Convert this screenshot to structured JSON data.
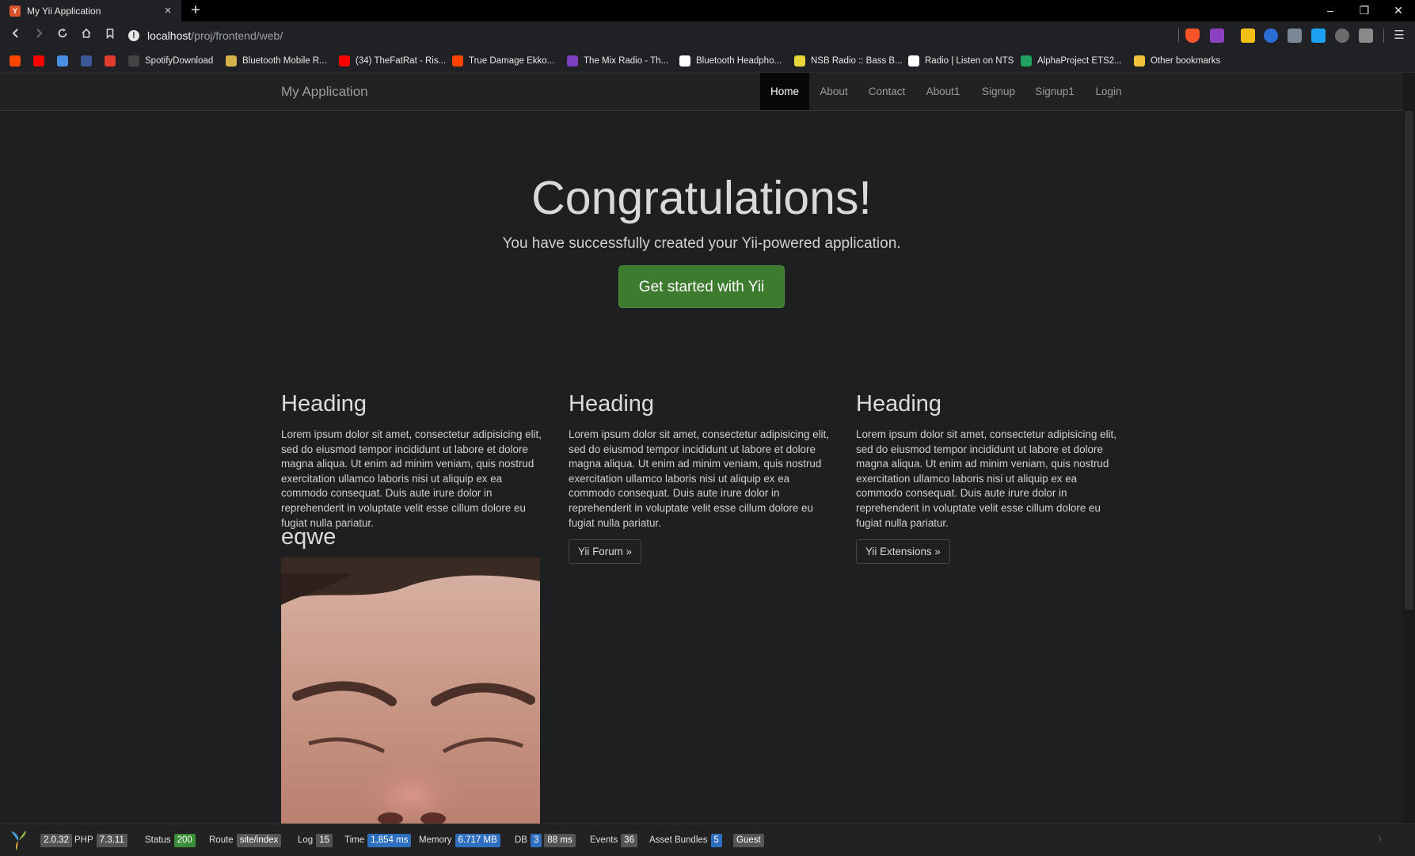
{
  "browser": {
    "tab_title": "My Yii Application",
    "tab_favicon": "yii-icon",
    "url_host": "localhost",
    "url_path": "/proj/frontend/web/",
    "bookmarks": [
      {
        "label": "",
        "icon": "reddit-icon",
        "color": "#ff4500"
      },
      {
        "label": "",
        "icon": "youtube-icon",
        "color": "#ff0000"
      },
      {
        "label": "",
        "icon": "messenger-icon",
        "color": "#4a90e2"
      },
      {
        "label": "",
        "icon": "facebook-icon",
        "color": "#3b5998"
      },
      {
        "label": "",
        "icon": "x-icon",
        "color": "#e03b2c"
      },
      {
        "label": "SpotifyDownload",
        "icon": "github-icon",
        "color": "#444444"
      },
      {
        "label": "Bluetooth Mobile R...",
        "icon": "bookmark-icon",
        "color": "#d6b24a"
      },
      {
        "label": "(34) TheFatRat - Ris...",
        "icon": "youtube-icon",
        "color": "#ff0000"
      },
      {
        "label": "True Damage Ekko...",
        "icon": "reddit-icon",
        "color": "#ff4500"
      },
      {
        "label": "The Mix Radio - Th...",
        "icon": "x-icon",
        "color": "#7b3fbf"
      },
      {
        "label": "Bluetooth Headpho...",
        "icon": "amazon-icon",
        "color": "#ffffff"
      },
      {
        "label": "NSB Radio :: Bass B...",
        "icon": "nsb-icon",
        "color": "#e8d63a"
      },
      {
        "label": "Radio | Listen on NTS",
        "icon": "nts-icon",
        "color": "#ffffff"
      },
      {
        "label": "AlphaProject ETS2...",
        "icon": "sheets-icon",
        "color": "#1fa463"
      },
      {
        "label": "Other bookmarks",
        "icon": "folder-icon",
        "color": "#f3c13a"
      }
    ]
  },
  "navbar": {
    "brand": "My Application",
    "items": [
      {
        "label": "Home",
        "active": true
      },
      {
        "label": "About"
      },
      {
        "label": "Contact"
      },
      {
        "label": "About1"
      },
      {
        "label": "Signup"
      },
      {
        "label": "Signup1"
      },
      {
        "label": "Login"
      }
    ]
  },
  "jumbotron": {
    "title": "Congratulations!",
    "lead": "You have successfully created your Yii-powered application.",
    "button": "Get started with Yii"
  },
  "columns": [
    {
      "heading": "Heading",
      "text": "Lorem ipsum dolor sit amet, consectetur adipisicing elit, sed do eiusmod tempor incididunt ut labore et dolore magna aliqua. Ut enim ad minim veniam, quis nostrud exercitation ullamco laboris nisi ut aliquip ex ea commodo consequat. Duis aute irure dolor in reprehenderit in voluptate velit esse cillum dolore eu fugiat nulla pariatur.",
      "button": ""
    },
    {
      "heading": "Heading",
      "text": "Lorem ipsum dolor sit amet, consectetur adipisicing elit, sed do eiusmod tempor incididunt ut labore et dolore magna aliqua. Ut enim ad minim veniam, quis nostrud exercitation ullamco laboris nisi ut aliquip ex ea commodo consequat. Duis aute irure dolor in reprehenderit in voluptate velit esse cillum dolore eu fugiat nulla pariatur.",
      "button": "Yii Forum »"
    },
    {
      "heading": "Heading",
      "text": "Lorem ipsum dolor sit amet, consectetur adipisicing elit, sed do eiusmod tempor incididunt ut labore et dolore magna aliqua. Ut enim ad minim veniam, quis nostrud exercitation ullamco laboris nisi ut aliquip ex ea commodo consequat. Duis aute irure dolor in reprehenderit in voluptate velit esse cillum dolore eu fugiat nulla pariatur.",
      "button": "Yii Extensions »"
    }
  ],
  "extra": {
    "heading": "eqwe"
  },
  "debug": {
    "yii_version": "2.0.32",
    "php_label": "PHP",
    "php_version": "7.3.11",
    "status_label": "Status",
    "status": "200",
    "route_label": "Route",
    "route": "site/index",
    "log_label": "Log",
    "log": "15",
    "time_label": "Time",
    "time": "1,854 ms",
    "memory_label": "Memory",
    "memory": "6.717 MB",
    "db_label": "DB",
    "db_count": "3",
    "db_time": "88 ms",
    "events_label": "Events",
    "events": "36",
    "assets_label": "Asset Bundles",
    "assets": "5",
    "user": "Guest"
  },
  "colors": {
    "page_bg": "#1e1f20",
    "navbar_bg": "#222222",
    "cta_green": "#3d7c2f",
    "badge_blue": "#2f6fbf",
    "badge_green": "#3a8e3a"
  }
}
